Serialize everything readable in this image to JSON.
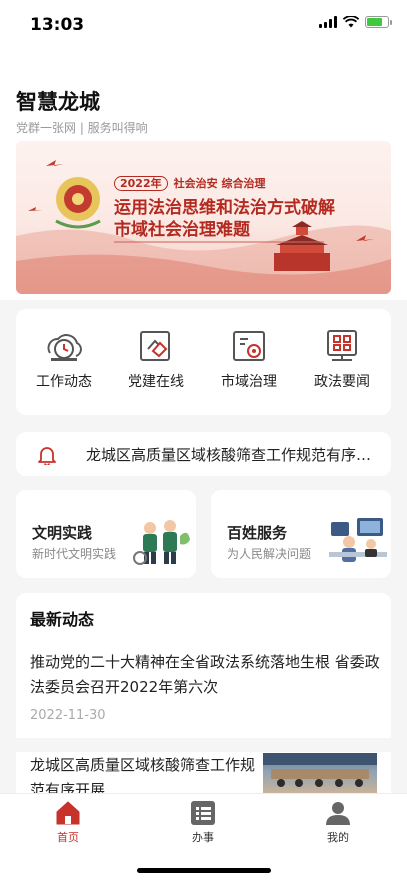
{
  "status_bar": {
    "time": "13:03"
  },
  "header": {
    "title": "智慧龙城",
    "subtitle": "党群一张网 | 服务叫得响"
  },
  "banner": {
    "year_tag": "2022年",
    "tag_line": "社会治安 综合治理",
    "headline_1": "运用法治思维和法治方式破解",
    "headline_2": "市域社会治理难题"
  },
  "menu": [
    {
      "label": "工作动态",
      "icon": "work-updates-icon"
    },
    {
      "label": "党建在线",
      "icon": "party-building-icon"
    },
    {
      "label": "市域治理",
      "icon": "city-governance-icon"
    },
    {
      "label": "政法要闻",
      "icon": "legal-news-icon"
    }
  ],
  "notice": {
    "text": "龙城区高质量区域核酸筛查工作规范有序开展"
  },
  "features": [
    {
      "title": "文明实践",
      "subtitle": "新时代文明实践"
    },
    {
      "title": "百姓服务",
      "subtitle": "为人民解决问题"
    }
  ],
  "news": {
    "heading": "最新动态",
    "items": [
      {
        "title": "推动党的二十大精神在全省政法系统落地生根 省委政法委员会召开2022年第六次",
        "date": "2022-11-30"
      },
      {
        "title": "龙城区高质量区域核酸筛查工作规范有序开展"
      }
    ]
  },
  "tab_bar": [
    {
      "label": "首页",
      "active": true
    },
    {
      "label": "办事",
      "active": false
    },
    {
      "label": "我的",
      "active": false
    }
  ],
  "colors": {
    "brand_red": "#c7322a",
    "icon_gray": "#555555"
  }
}
